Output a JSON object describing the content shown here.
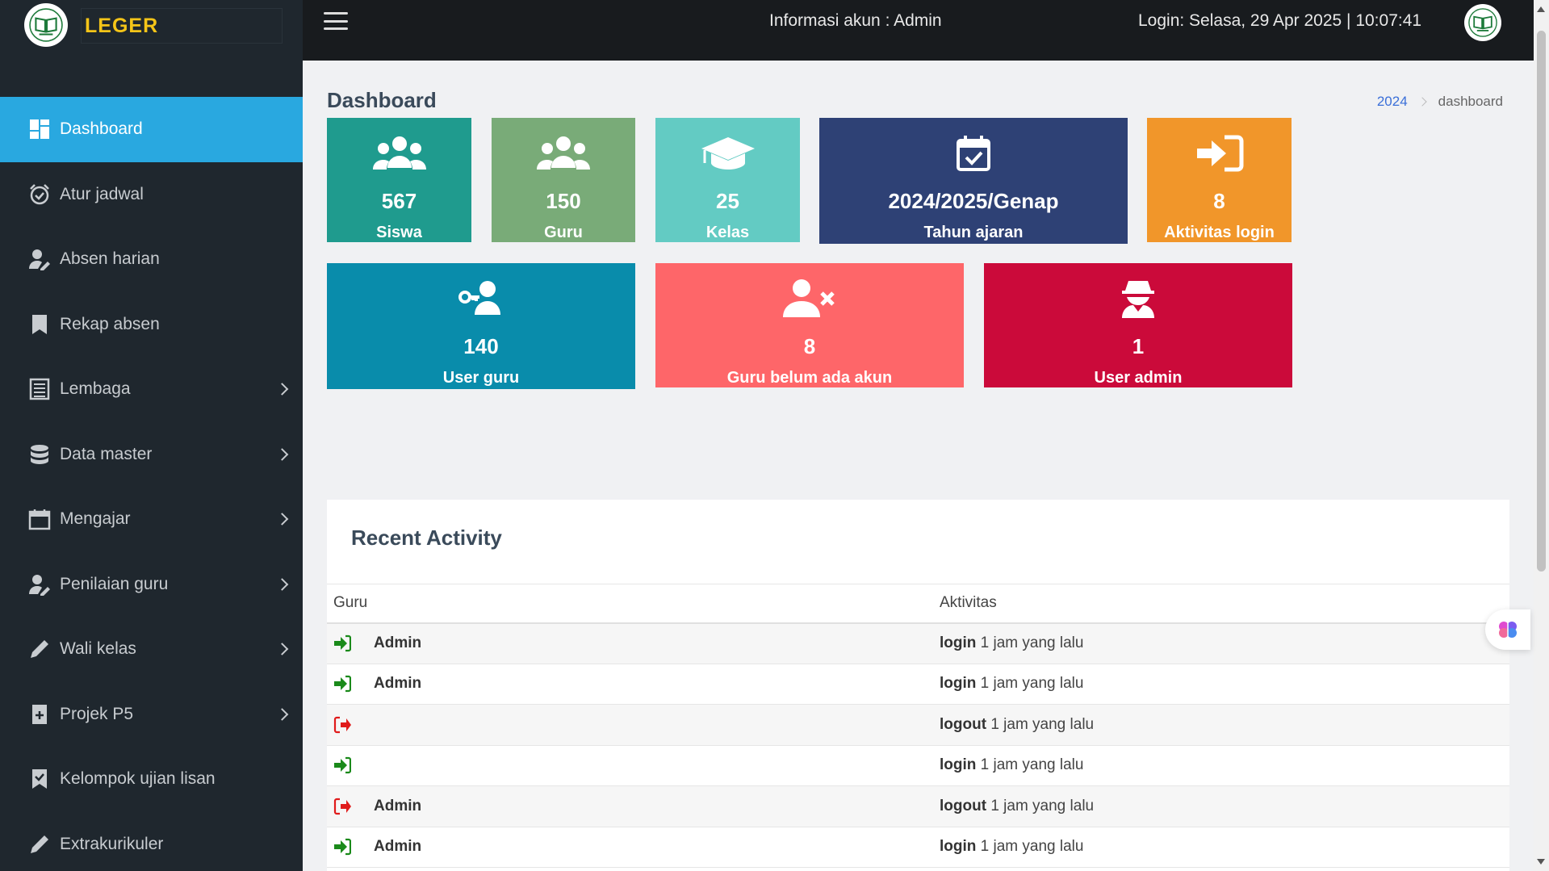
{
  "brand": {
    "name": "LEGER"
  },
  "header": {
    "account_info": "Informasi akun : Admin",
    "login_info": "Login: Selasa, 29 Apr 2025 | 10:07:41"
  },
  "sidebar": {
    "items": [
      {
        "label": "Dashboard",
        "icon": "dashboard-icon",
        "active": true
      },
      {
        "label": "Atur jadwal",
        "icon": "alarm-clock-icon"
      },
      {
        "label": "Absen harian",
        "icon": "user-edit-icon"
      },
      {
        "label": "Rekap absen",
        "icon": "bookmark-icon"
      },
      {
        "label": "Lembaga",
        "icon": "list-icon",
        "submenu": true
      },
      {
        "label": "Data master",
        "icon": "database-icon",
        "submenu": true
      },
      {
        "label": "Mengajar",
        "icon": "calendar-icon",
        "submenu": true
      },
      {
        "label": "Penilaian guru",
        "icon": "user-edit-icon",
        "submenu": true
      },
      {
        "label": "Wali kelas",
        "icon": "pencil-icon",
        "submenu": true
      },
      {
        "label": "Projek P5",
        "icon": "book-plus-icon",
        "submenu": true
      },
      {
        "label": "Kelompok ujian lisan",
        "icon": "bookmark-check-icon"
      },
      {
        "label": "Extrakurikuler",
        "icon": "pencil-icon"
      }
    ]
  },
  "page": {
    "title": "Dashboard",
    "breadcrumb": {
      "home": "2024",
      "current": "dashboard"
    }
  },
  "stats": [
    {
      "value": "567",
      "label": "Siswa",
      "color": "#1f9b8e",
      "icon": "users-icon"
    },
    {
      "value": "150",
      "label": "Guru",
      "color": "#79ab78",
      "icon": "users-icon"
    },
    {
      "value": "25",
      "label": "Kelas",
      "color": "#63cbc3",
      "icon": "graduation-cap-icon"
    },
    {
      "value": "2024/2025/Genap",
      "label": "Tahun ajaran",
      "color": "#2e4175",
      "icon": "calendar-check-icon"
    },
    {
      "value": "8",
      "label": "Aktivitas login",
      "color": "#f1962a",
      "icon": "sign-in-icon"
    },
    {
      "value": "140",
      "label": "User guru",
      "color": "#098cab",
      "icon": "user-key-icon"
    },
    {
      "value": "8",
      "label": "Guru belum ada akun",
      "color": "#fe6669",
      "icon": "user-x-icon"
    },
    {
      "value": "1",
      "label": "User admin",
      "color": "#cb0a3a",
      "icon": "user-secret-icon"
    }
  ],
  "activity": {
    "title": "Recent Activity",
    "columns": [
      "Guru",
      "Aktivitas"
    ],
    "rows": [
      {
        "type": "login",
        "guru": "Admin",
        "action": "login",
        "time": "1 jam yang lalu"
      },
      {
        "type": "login",
        "guru": "Admin",
        "action": "login",
        "time": "1 jam yang lalu"
      },
      {
        "type": "logout",
        "guru": "",
        "action": "logout",
        "time": "1 jam yang lalu"
      },
      {
        "type": "login",
        "guru": "",
        "action": "login",
        "time": "1 jam yang lalu"
      },
      {
        "type": "logout",
        "guru": "Admin",
        "action": "logout",
        "time": "1 jam yang lalu"
      },
      {
        "type": "login",
        "guru": "Admin",
        "action": "login",
        "time": "1 jam yang lalu"
      }
    ]
  },
  "colors": {
    "sidebar_bg": "#1f272e",
    "sidebar_active": "#29a8e0",
    "header_bg": "#181b1e",
    "brand_accent": "#f5c518",
    "login_icon": "#1a8a1a",
    "logout_icon": "#e01b1b"
  }
}
